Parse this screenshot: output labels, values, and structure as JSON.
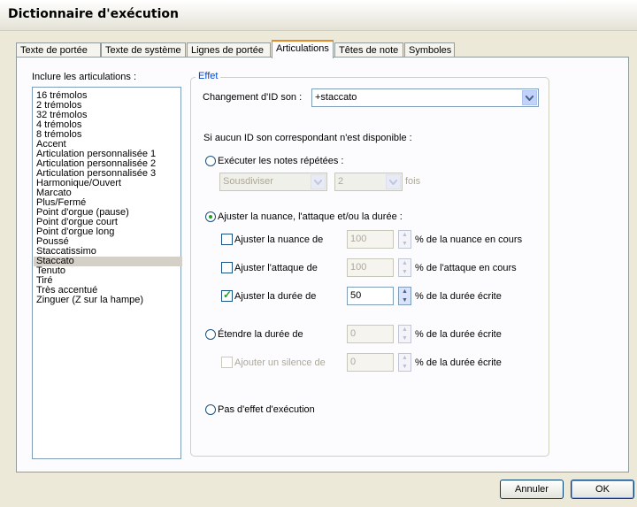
{
  "window": {
    "title": "Dictionnaire d'exécution"
  },
  "tabs": [
    {
      "label": "Texte de portée"
    },
    {
      "label": "Texte de système"
    },
    {
      "label": "Lignes de portée"
    },
    {
      "label": "Articulations",
      "active": true
    },
    {
      "label": "Têtes de note"
    },
    {
      "label": "Symboles"
    }
  ],
  "list": {
    "label": "Inclure les articulations :",
    "items": [
      "16 trémolos",
      "2 trémolos",
      "32 trémolos",
      "4 trémolos",
      "8 trémolos",
      "Accent",
      "Articulation personnalisée 1",
      "Articulation personnalisée 2",
      "Articulation personnalisée 3",
      "Harmonique/Ouvert",
      "Marcato",
      "Plus/Fermé",
      "Point d'orgue (pause)",
      "Point d'orgue court",
      "Point d'orgue long",
      "Poussé",
      "Staccatissimo",
      "Staccato",
      "Tenuto",
      "Tiré",
      "Très accentué",
      "Zinguer (Z sur la hampe)"
    ],
    "selected": "Staccato"
  },
  "effet": {
    "title": "Effet",
    "change_label": "Changement d'ID son :",
    "change_value": "+staccato",
    "note": "Si aucun ID son correspondant n'est disponible :",
    "option1": {
      "label": "Exécuter les notes répétées :",
      "mode_value": "Sousdiviser",
      "count_value": "2",
      "suffix": "fois"
    },
    "option2": {
      "label": "Ajuster la nuance, l'attaque et/ou la durée :",
      "nuance_label": "Ajuster la nuance de",
      "nuance_value": "100",
      "nuance_suffix": "% de la nuance en cours",
      "attaque_label": "Ajuster l'attaque de",
      "attaque_value": "100",
      "attaque_suffix": "% de l'attaque en cours",
      "duree_label": "Ajuster la durée de",
      "duree_value": "50",
      "duree_suffix": "% de la durée écrite"
    },
    "option3": {
      "label": "Étendre la durée de",
      "value": "0",
      "suffix": "% de la durée écrite",
      "silence_label": "Ajouter un silence de",
      "silence_value": "0",
      "silence_suffix": "% de la durée écrite"
    },
    "option4": {
      "label": "Pas d'effet d'exécution"
    }
  },
  "buttons": {
    "cancel": "Annuler",
    "ok": "OK"
  }
}
